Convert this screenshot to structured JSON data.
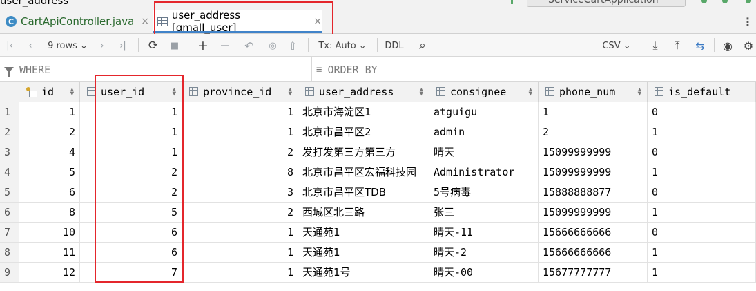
{
  "window": {
    "cut_title": "user_address"
  },
  "tabs": [
    {
      "icon": "C",
      "label": "CartApiController.java",
      "active": false
    },
    {
      "label": "user_address [gmall_user]",
      "active": true
    }
  ],
  "run_config": {
    "label": "ServiceCartApplication"
  },
  "toolbar": {
    "rows_label": "9 rows",
    "tx_label": "Tx: Auto",
    "ddl_label": "DDL",
    "csv_label": "CSV"
  },
  "filter": {
    "where_label": "WHERE",
    "orderby_label": "ORDER BY"
  },
  "table": {
    "columns": [
      "id",
      "user_id",
      "province_id",
      "user_address",
      "consignee",
      "phone_num",
      "is_default"
    ],
    "rows": [
      {
        "rownum": "1",
        "id": "1",
        "user_id": "1",
        "province_id": "1",
        "user_address": "北京市海淀区1",
        "consignee": "atguigu",
        "phone_num": "1",
        "is_default": "0"
      },
      {
        "rownum": "2",
        "id": "2",
        "user_id": "1",
        "province_id": "1",
        "user_address": "北京市昌平区2",
        "consignee": "admin",
        "phone_num": "2",
        "is_default": "1"
      },
      {
        "rownum": "3",
        "id": "4",
        "user_id": "1",
        "province_id": "2",
        "user_address": "发打发第三方第三方",
        "consignee": "晴天",
        "phone_num": "15099999999",
        "is_default": "0"
      },
      {
        "rownum": "4",
        "id": "5",
        "user_id": "2",
        "province_id": "8",
        "user_address": "北京市昌平区宏福科技园",
        "consignee": "Administrator",
        "phone_num": "15099999999",
        "is_default": "1"
      },
      {
        "rownum": "5",
        "id": "6",
        "user_id": "2",
        "province_id": "3",
        "user_address": "北京市昌平区TDB",
        "consignee": "5号病毒",
        "phone_num": "15888888877",
        "is_default": "0"
      },
      {
        "rownum": "6",
        "id": "8",
        "user_id": "5",
        "province_id": "2",
        "user_address": "西城区北三路",
        "consignee": "张三",
        "phone_num": "15099999999",
        "is_default": "1"
      },
      {
        "rownum": "7",
        "id": "10",
        "user_id": "6",
        "province_id": "1",
        "user_address": "天通苑1",
        "consignee": "晴天-11",
        "phone_num": "15666666666",
        "is_default": "0"
      },
      {
        "rownum": "8",
        "id": "11",
        "user_id": "6",
        "province_id": "1",
        "user_address": "天通苑1",
        "consignee": "晴天-2",
        "phone_num": "15666666666",
        "is_default": "1"
      },
      {
        "rownum": "9",
        "id": "12",
        "user_id": "7",
        "province_id": "1",
        "user_address": "天通苑1号",
        "consignee": "晴天-00",
        "phone_num": "15677777777",
        "is_default": "1"
      }
    ]
  },
  "colors": {
    "highlight": "#e4262c",
    "active_tab_underline": "#4083c9",
    "class_icon": "#3d8bc4"
  }
}
